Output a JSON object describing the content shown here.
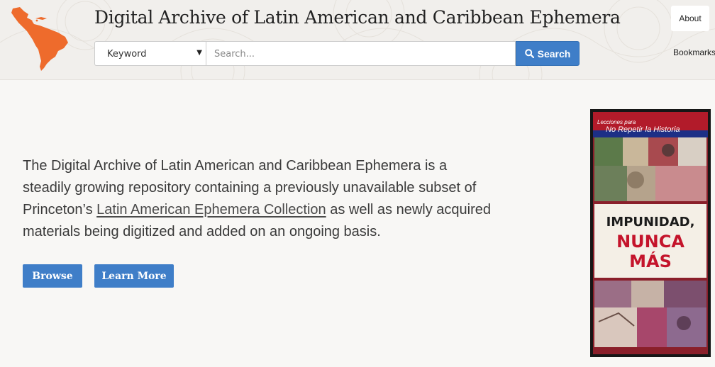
{
  "header": {
    "title": "Digital Archive of Latin American and Caribbean Ephemera",
    "search": {
      "field_selected": "Keyword",
      "placeholder": "Search...",
      "button_label": "Search"
    },
    "nav": {
      "about": "About",
      "bookmarks": "Bookmarks"
    }
  },
  "intro": {
    "text_before_link": "The Digital Archive of Latin American and Caribbean Ephemera is a steadily growing repository containing a previously unavailable subset of Princeton’s ",
    "link_text": "Latin American Ephemera Collection",
    "text_after_link": " as well as newly acquired materials being digitized and added on an ongoing basis."
  },
  "actions": {
    "browse": "Browse",
    "learn_more": "Learn More"
  },
  "poster": {
    "top_line_1": "Lecciones para",
    "top_line_2": "No Repetir la Historia",
    "headline_1": "IMPUNIDAD,",
    "headline_2": "NUNCA",
    "headline_3": "MÁS"
  },
  "colors": {
    "accent": "#3f7ec8",
    "logo": "#ee6b2c",
    "poster_red": "#c4142b"
  }
}
